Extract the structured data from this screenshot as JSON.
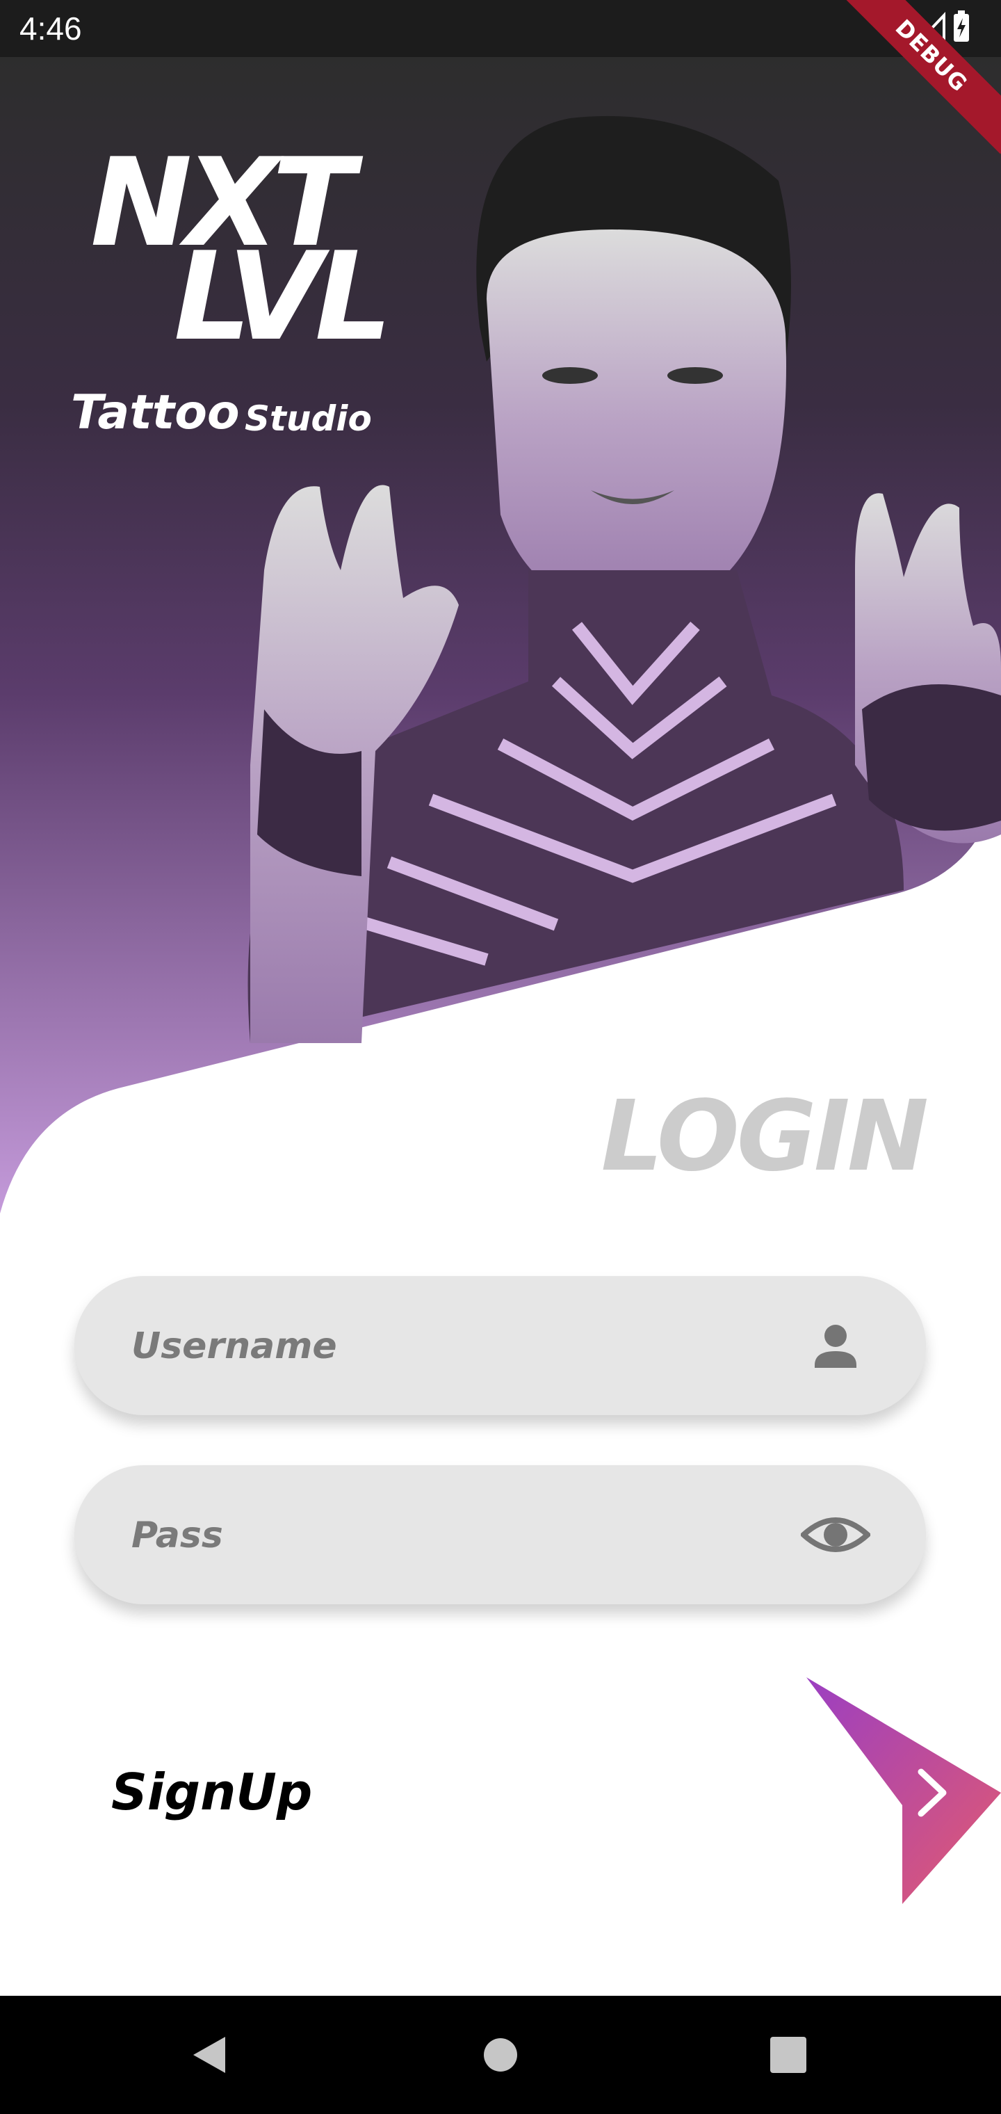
{
  "status_bar": {
    "time": "4:46",
    "icons": [
      "wifi-icon",
      "signal-icon",
      "battery-icon"
    ]
  },
  "debug_banner": "DEBUG",
  "logo": {
    "line1": "NXT",
    "line2": "LVL",
    "tattoo": "Tattoo",
    "studio": "Studio"
  },
  "login_title": "LOGIN",
  "form": {
    "username_placeholder": "Username",
    "username_value": "",
    "username_icon": "person-icon",
    "password_placeholder": "Pass",
    "password_value": "",
    "password_icon": "eye-icon"
  },
  "signup_label": "SignUp",
  "submit_icon": "chevron-right-icon",
  "nav_bar": {
    "icons": [
      "back-icon",
      "home-icon",
      "recents-icon"
    ]
  },
  "colors": {
    "status_bar": "#1c1c1c",
    "hero_top": "#2d2d2d",
    "hero_purple": "#5b3c6c",
    "hero_light_purple": "#c49ada",
    "field_bg": "#e6e6e6",
    "login_title": "#cccccc",
    "placeholder": "#7a7a7a",
    "arrow_gradient_start": "#9b3fc2",
    "arrow_gradient_end": "#e25a70",
    "debug_banner": "#a4182b",
    "nav_bar": "#000000"
  }
}
